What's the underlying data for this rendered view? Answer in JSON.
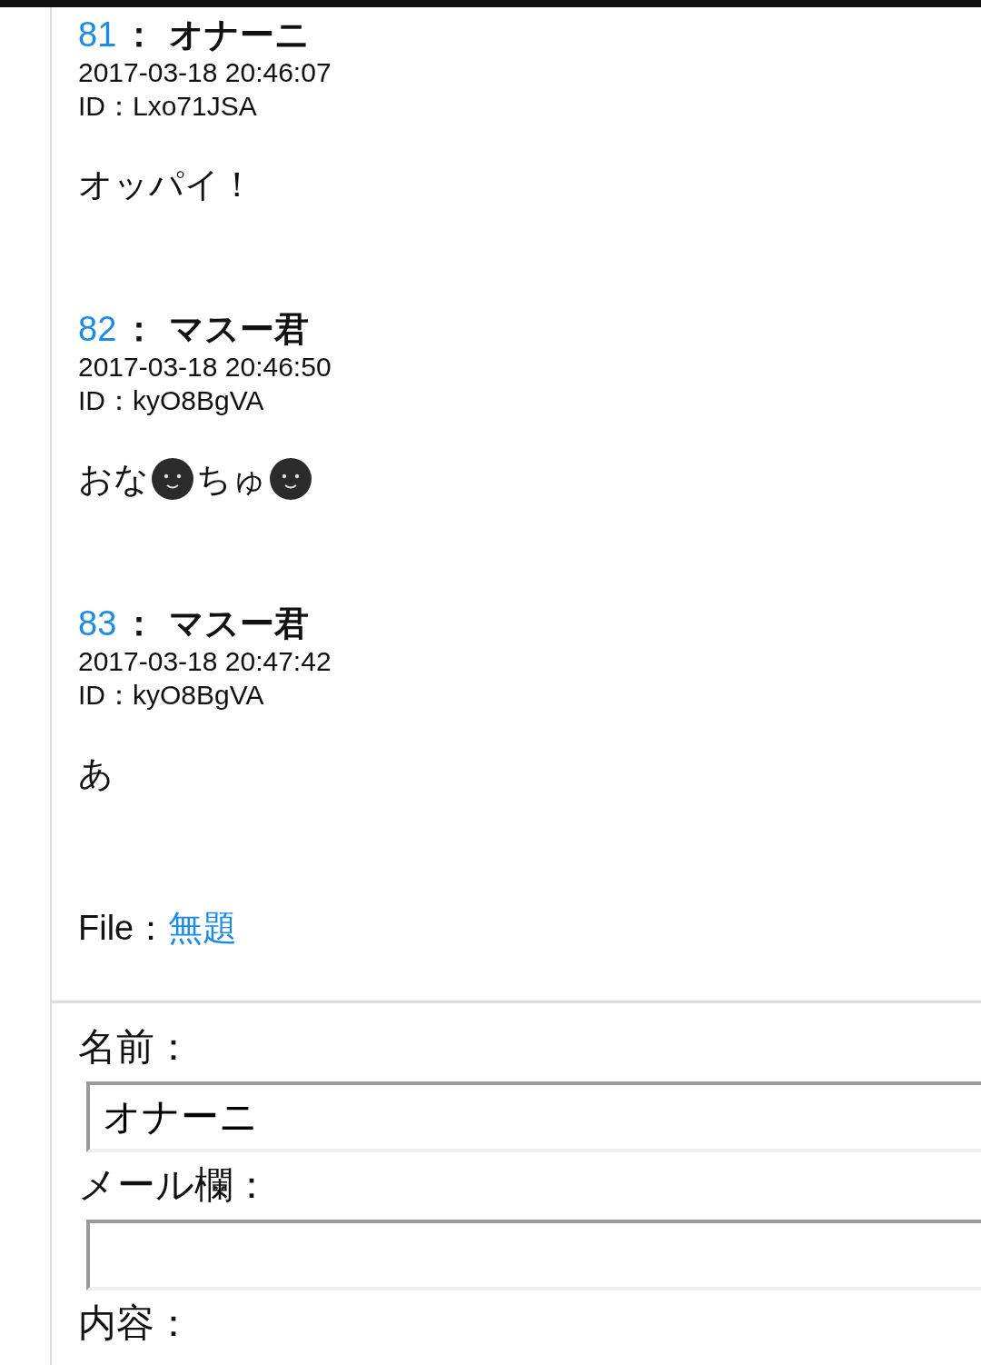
{
  "posts": [
    {
      "number": "81",
      "separator": "：",
      "name": "オナーニ",
      "date": "2017-03-18 20:46:07",
      "id_label": "ID：",
      "id": "Lxo71JSA",
      "body": [
        {
          "kind": "text",
          "text": "オッパイ！"
        }
      ]
    },
    {
      "number": "82",
      "separator": "：",
      "name": "マスー君",
      "date": "2017-03-18 20:46:50",
      "id_label": "ID：",
      "id": "kyO8BgVA",
      "body": [
        {
          "kind": "text",
          "text": "おな"
        },
        {
          "kind": "emoji"
        },
        {
          "kind": "text",
          "text": "ちゅ"
        },
        {
          "kind": "emoji"
        }
      ]
    },
    {
      "number": "83",
      "separator": "：",
      "name": "マスー君",
      "date": "2017-03-18 20:47:42",
      "id_label": "ID：",
      "id": "kyO8BgVA",
      "body": [
        {
          "kind": "text",
          "text": "あ"
        }
      ]
    }
  ],
  "file": {
    "label": "File：",
    "link": "無題"
  },
  "form": {
    "name_label": "名前：",
    "name_value": "オナーニ",
    "mail_label": "メール欄：",
    "content_label": "内容："
  }
}
